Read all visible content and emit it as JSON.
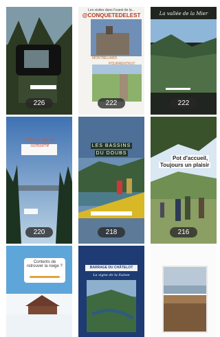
{
  "stories": [
    {
      "views": "226",
      "caption": ""
    },
    {
      "views": "222",
      "title": "Les visites dans l'ouest de la...",
      "tag": "@CONQUETEDELEST",
      "place1": "MONTBELIARD",
      "place2": "POURRENTRUY"
    },
    {
      "views": "222",
      "title": "La vallée de la Mier"
    },
    {
      "views": "220",
      "title": "Plaisir de la lumière"
    },
    {
      "views": "218",
      "title_line1": "LES BASSINS",
      "title_line2": "DU DOUBS"
    },
    {
      "views": "216",
      "title_line1": "Pot d'accueil,",
      "title_line2": "Toujours un plaisir"
    },
    {
      "views": "",
      "question": "Contents de retrouver la neige ?"
    },
    {
      "views": "",
      "tag": "BARRAGE DU CHÂTELOT",
      "subtitle": "La vigne de la Suisse"
    },
    {
      "views": ""
    }
  ]
}
